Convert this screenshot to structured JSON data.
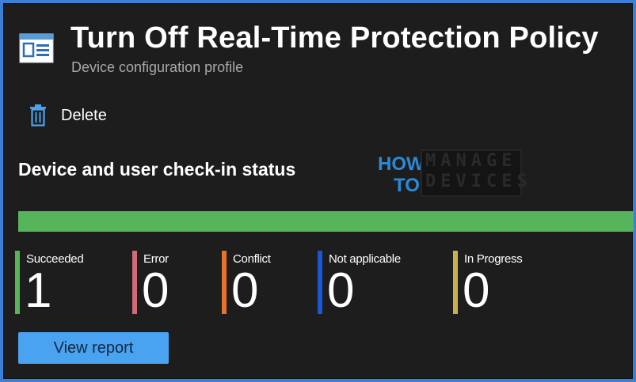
{
  "header": {
    "title": "Turn Off Real-Time Protection Policy",
    "subtitle": "Device configuration profile",
    "icon": "configuration-profile-icon"
  },
  "toolbar": {
    "delete_label": "Delete",
    "delete_icon": "trash-icon"
  },
  "status": {
    "title": "Device and user check-in status",
    "progress_succeeded_fraction": 1.0,
    "progress_color": "#56b55a",
    "items": [
      {
        "label": "Succeeded",
        "value": "1",
        "color": "#56b55a"
      },
      {
        "label": "Error",
        "value": "0",
        "color": "#d26a77"
      },
      {
        "label": "Conflict",
        "value": "0",
        "color": "#e8742a"
      },
      {
        "label": "Not applicable",
        "value": "0",
        "color": "#1a57d4"
      },
      {
        "label": "In Progress",
        "value": "0",
        "color": "#c9b04e"
      }
    ],
    "view_report_label": "View report"
  },
  "watermark": {
    "how": "HOW",
    "to": "TO",
    "manage": "MANAGE",
    "devices": "DEVICES"
  },
  "colors": {
    "accent": "#4aa3f0",
    "background": "#1d1d1d",
    "frame_border": "#3b7fd6"
  }
}
